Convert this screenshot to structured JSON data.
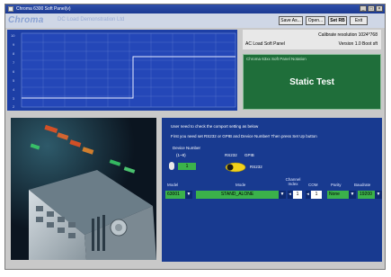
{
  "window": {
    "title": "Chroma 6300 Soft Panel(v)"
  },
  "header": {
    "brand": "Chroma",
    "subtitle": "DC Load Demonstration Ltd"
  },
  "toolbar": {
    "buttons": [
      "Save As...",
      "Open...",
      "Set RB",
      "Exit"
    ]
  },
  "info": {
    "line1_left": "",
    "line1_right": "Calibrate resolution 1024*768",
    "line2_left": "AC Load Soft Panel",
    "line2_right": "Version 1.0 Boot sft"
  },
  "status_panel": {
    "header": "Chroma 63xx Soft Panel Notation",
    "mode_text": "Static Test"
  },
  "control": {
    "line1": "User need to check the comport setting as below",
    "line2": "First you need set RS232 or GPIB and Device Number! Then press Set Up button",
    "device_number_label": "Device Number",
    "device_range": "(1~8)",
    "device_number_value": "1",
    "rs232_label": "RS232",
    "gpib_label": "GPIB",
    "rs232_option": "RS232",
    "columns": [
      "Model",
      "Mode",
      "Channel Index",
      "COM",
      "Parity",
      "Baudrate"
    ],
    "model_value": "63001",
    "mode_value": "STAND_ALONE",
    "channel_value": "1",
    "com_value": "1",
    "parity_value": "None",
    "baud_value": "19200"
  },
  "colors": {
    "chart_bg": "#1d3fa6",
    "status_bg": "#1f6e3a",
    "panel_bg": "#183a90",
    "accent_green": "#3bb24a"
  }
}
